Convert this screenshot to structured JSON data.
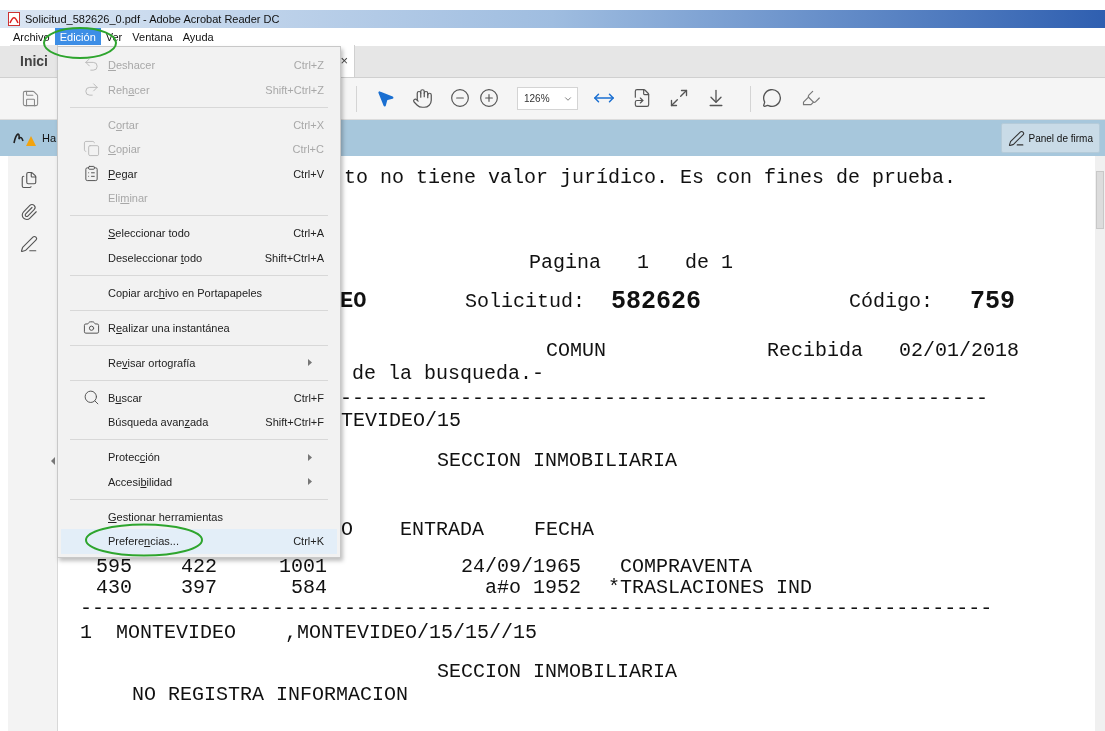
{
  "window": {
    "title": "Solicitud_582626_0.pdf - Adobe Acrobat Reader DC"
  },
  "menubar": [
    {
      "label": "Archivo",
      "selected": false
    },
    {
      "label": "Edición",
      "selected": true
    },
    {
      "label": "Ver",
      "selected": false
    },
    {
      "label": "Ventana",
      "selected": false
    },
    {
      "label": "Ayuda",
      "selected": false
    }
  ],
  "tabs": [
    {
      "label": "Inici",
      "selected": false
    },
    {
      "close": "×",
      "selected": true
    }
  ],
  "toolbar": {
    "zoom": "126%"
  },
  "notice_bar": {
    "text": "Ha",
    "button": "Panel de firma"
  },
  "edit_menu": [
    {
      "kind": "item",
      "key": "D",
      "post": "eshacer",
      "shortcut": "Ctrl+Z",
      "disabled": true,
      "selected": false
    },
    {
      "kind": "item",
      "pre": "Reh",
      "key": "a",
      "post": "cer",
      "shortcut": "Shift+Ctrl+Z",
      "disabled": true,
      "selected": false
    },
    {
      "kind": "separator"
    },
    {
      "kind": "item",
      "pre": "C",
      "key": "o",
      "post": "rtar",
      "shortcut": "Ctrl+X",
      "disabled": true,
      "selected": false
    },
    {
      "kind": "item",
      "key": "C",
      "post": "opiar",
      "shortcut": "Ctrl+C",
      "disabled": true,
      "selected": false
    },
    {
      "kind": "item",
      "key": "P",
      "post": "egar",
      "shortcut": "Ctrl+V",
      "disabled": false,
      "selected": false
    },
    {
      "kind": "item",
      "pre": "Eli",
      "key": "m",
      "post": "inar",
      "disabled": true,
      "selected": false
    },
    {
      "kind": "separator"
    },
    {
      "kind": "item",
      "key": "S",
      "post": "eleccionar todo",
      "shortcut": "Ctrl+A",
      "disabled": false,
      "selected": false
    },
    {
      "kind": "item",
      "pre": "Deseleccionar ",
      "key": "t",
      "post": "odo",
      "shortcut": "Shift+Ctrl+A",
      "disabled": false,
      "selected": false
    },
    {
      "kind": "separator"
    },
    {
      "kind": "item",
      "pre": "Copiar arc",
      "key": "h",
      "post": "ivo en Portapapeles",
      "disabled": false,
      "selected": false
    },
    {
      "kind": "separator"
    },
    {
      "kind": "item",
      "pre": "R",
      "key": "e",
      "post": "alizar una instantánea",
      "disabled": false,
      "selected": false
    },
    {
      "kind": "separator"
    },
    {
      "kind": "submenu",
      "pre": "Re",
      "key": "v",
      "post": "isar ortografía",
      "disabled": false,
      "selected": false
    },
    {
      "kind": "separator"
    },
    {
      "kind": "item",
      "pre": "B",
      "key": "u",
      "post": "scar",
      "shortcut": "Ctrl+F",
      "disabled": false,
      "selected": false
    },
    {
      "kind": "item",
      "pre": "Búsqueda avan",
      "key": "z",
      "post": "ada",
      "shortcut": "Shift+Ctrl+F",
      "disabled": false,
      "selected": false
    },
    {
      "kind": "separator"
    },
    {
      "kind": "submenu",
      "pre": "Protec",
      "key": "c",
      "post": "ión",
      "disabled": false,
      "selected": false
    },
    {
      "kind": "submenu",
      "pre": "Accesi",
      "key": "b",
      "post": "ilidad",
      "disabled": false,
      "selected": false
    },
    {
      "kind": "separator"
    },
    {
      "kind": "item",
      "key": "G",
      "post": "estionar herramientas",
      "disabled": false,
      "selected": false
    },
    {
      "kind": "item",
      "pre": "Prefere",
      "key": "n",
      "post": "cias...",
      "shortcut": "Ctrl+K",
      "disabled": false,
      "selected": true
    }
  ],
  "document": [
    {
      "text": "to no tiene valor jurídico. Es con fines de prueba.",
      "kind": "plain"
    },
    {
      "text": "Pagina   1   de 1",
      "kind": "plain"
    },
    {
      "text": "EO",
      "kind": "bold"
    },
    {
      "text": "Solicitud:",
      "kind": "plain"
    },
    {
      "text": "582626",
      "kind": "bold"
    },
    {
      "text": "Código:",
      "kind": "plain"
    },
    {
      "text": "759",
      "kind": "bold"
    },
    {
      "text": "COMUN",
      "kind": "plain"
    },
    {
      "text": "Recibida   02/01/2018",
      "kind": "plain"
    },
    {
      "text": "de la busqueda.-",
      "kind": "plain"
    },
    {
      "text": "------------------------------------------------------",
      "kind": "plain"
    },
    {
      "text": "TEVIDEO/15",
      "kind": "plain"
    },
    {
      "text": "SECCION INMOBILIARIA",
      "kind": "plain"
    },
    {
      "text": "O",
      "kind": "plain"
    },
    {
      "text": "ENTRADA",
      "kind": "plain"
    },
    {
      "text": "FECHA",
      "kind": "plain"
    },
    {
      "text": "595",
      "kind": "plain"
    },
    {
      "text": "422",
      "kind": "plain"
    },
    {
      "text": "1001",
      "kind": "plain"
    },
    {
      "text": "24/09/1965",
      "kind": "plain"
    },
    {
      "text": "COMPRAVENTA",
      "kind": "plain"
    },
    {
      "text": "430",
      "kind": "plain"
    },
    {
      "text": "397",
      "kind": "plain"
    },
    {
      "text": "584",
      "kind": "plain"
    },
    {
      "text": "a#o 1952",
      "kind": "plain"
    },
    {
      "text": "*TRASLACIONES IND",
      "kind": "plain"
    },
    {
      "text": "----------------------------------------------------------------------------",
      "kind": "plain"
    },
    {
      "text": "1  MONTEVIDEO",
      "kind": "plain"
    },
    {
      "text": ",MONTEVIDEO/15/15//15",
      "kind": "plain"
    },
    {
      "text": "SECCION INMOBILIARIA",
      "kind": "plain"
    },
    {
      "text": "NO REGISTRA INFORMACION",
      "kind": "plain"
    }
  ]
}
